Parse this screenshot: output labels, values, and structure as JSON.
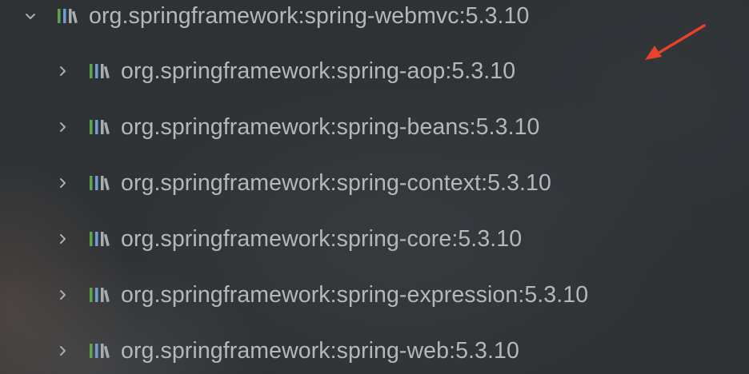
{
  "tree": {
    "root": {
      "label": "org.springframework:spring-webmvc:5.3.10",
      "expanded": true,
      "chevron_icon": "chevron-down-icon",
      "icon": "library-icon"
    },
    "children": [
      {
        "label": "org.springframework:spring-aop:5.3.10",
        "chevron_icon": "chevron-right-icon",
        "icon": "library-icon"
      },
      {
        "label": "org.springframework:spring-beans:5.3.10",
        "chevron_icon": "chevron-right-icon",
        "icon": "library-icon"
      },
      {
        "label": "org.springframework:spring-context:5.3.10",
        "chevron_icon": "chevron-right-icon",
        "icon": "library-icon"
      },
      {
        "label": "org.springframework:spring-core:5.3.10",
        "chevron_icon": "chevron-right-icon",
        "icon": "library-icon"
      },
      {
        "label": "org.springframework:spring-expression:5.3.10",
        "chevron_icon": "chevron-right-icon",
        "icon": "library-icon"
      },
      {
        "label": "org.springframework:spring-web:5.3.10",
        "chevron_icon": "chevron-right-icon",
        "icon": "library-icon"
      }
    ]
  },
  "annotation": {
    "icon": "red-arrow-icon",
    "color": "#e8412c"
  },
  "colors": {
    "text": "#b3b8bd",
    "chevron": "#a8adb2",
    "icon_bars": [
      "#5fa54f",
      "#6d9fd4",
      "#a8adb2",
      "#a8adb2"
    ]
  }
}
